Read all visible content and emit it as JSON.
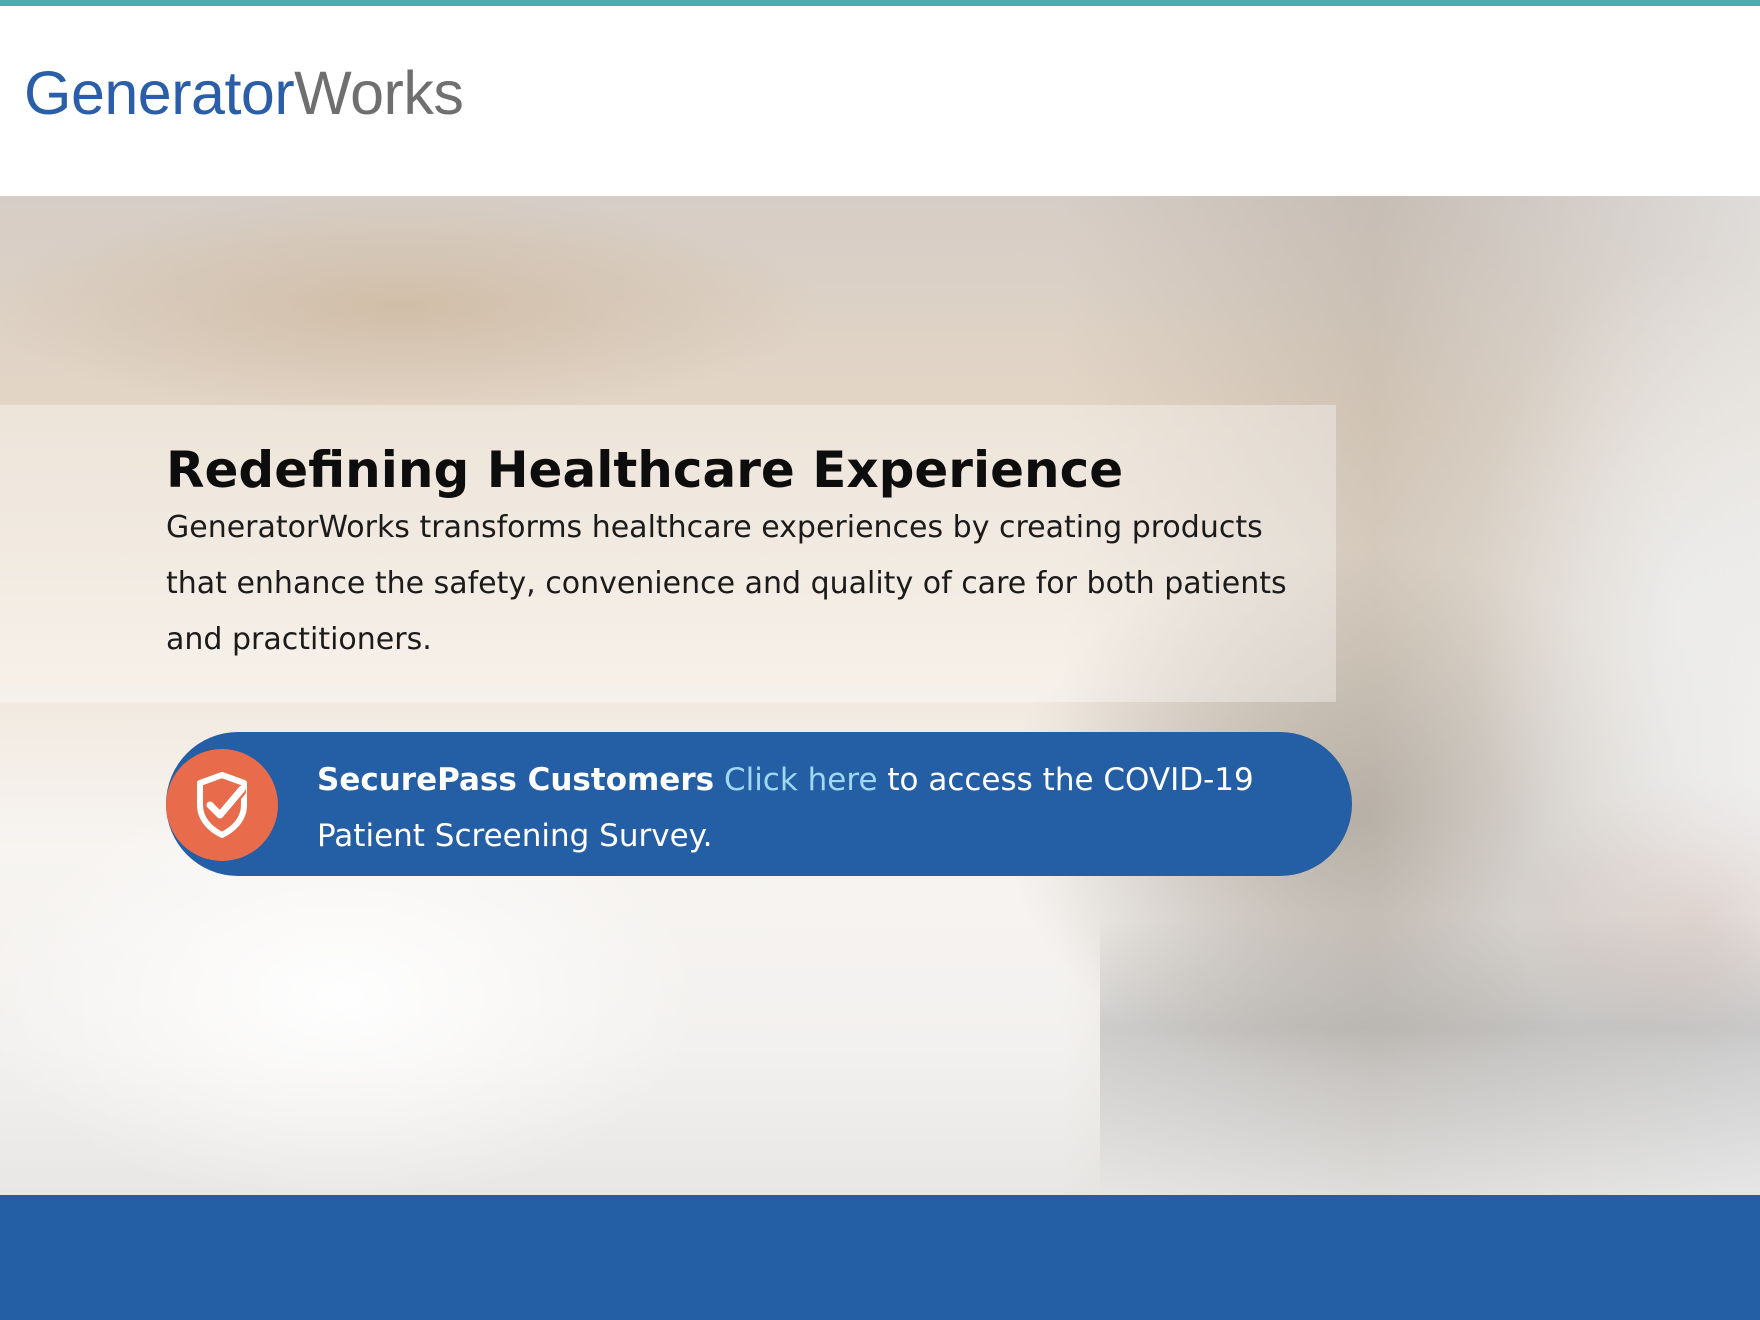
{
  "brand": {
    "logo_part1": "Generator",
    "logo_part2": "Works",
    "color_primary": "#2a5ea8",
    "color_secondary": "#6f6f6f",
    "accent_line_color": "#4aaeae"
  },
  "hero": {
    "title": "Redefining Healthcare Experience",
    "description": "GeneratorWorks transforms healthcare experiences by creating products that enhance the safety, convenience and quality of care for both patients and practitioners."
  },
  "securepass": {
    "icon": "shield-check-icon",
    "lead_text": "SecurePass Customers",
    "link_text": "Click here",
    "trailing_text": "to access the COVID-19 Patient Screening Survey.",
    "banner_color": "#245ea5",
    "badge_color": "#e86b4b",
    "link_color": "#9fd8f2"
  },
  "footer": {
    "bar_color": "#245ea5"
  }
}
